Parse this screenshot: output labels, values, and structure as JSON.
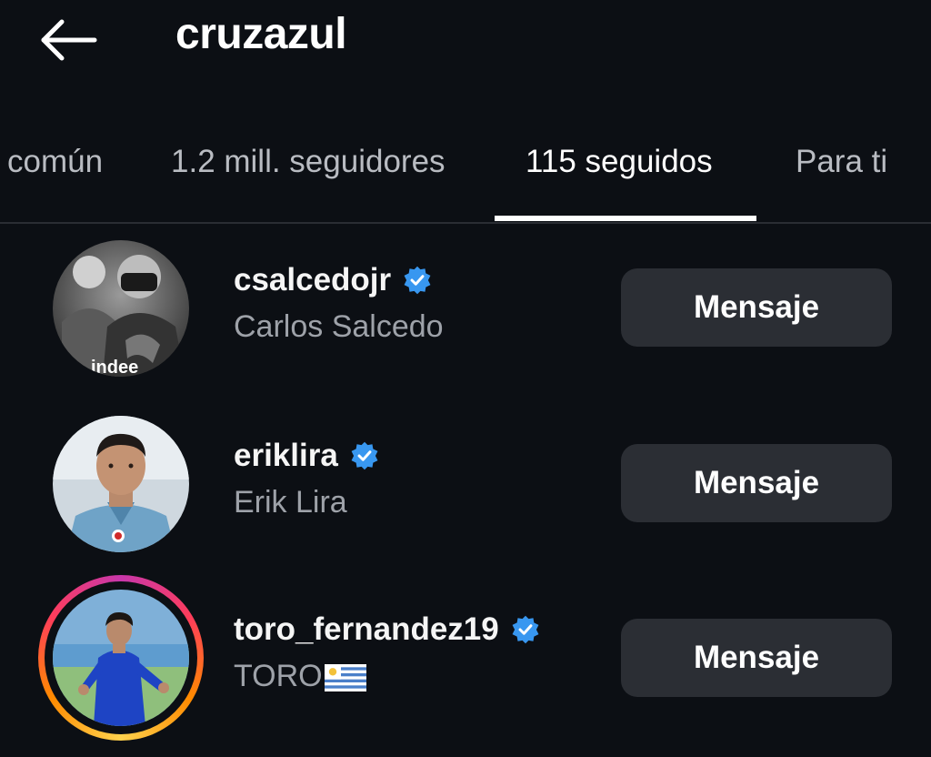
{
  "header": {
    "title": "cruzazul",
    "back_icon": "arrow-left-icon"
  },
  "tabs": [
    {
      "label": "común",
      "active": false
    },
    {
      "label": "1.2 mill. seguidores",
      "active": false
    },
    {
      "label": "115 seguidos",
      "active": true
    },
    {
      "label": "Para ti",
      "active": false
    }
  ],
  "accounts": [
    {
      "username": "csalcedojr",
      "full_name": "Carlos Salcedo",
      "verified": true,
      "has_story": false,
      "avatar_text": "indee",
      "button_label": "Mensaje"
    },
    {
      "username": "eriklira",
      "full_name": "Erik Lira",
      "verified": true,
      "has_story": false,
      "button_label": "Mensaje"
    },
    {
      "username": "toro_fernandez19",
      "full_name": "TORO",
      "full_name_suffix_icon": "uruguay-flag-icon",
      "verified": true,
      "has_story": true,
      "button_label": "Mensaje"
    }
  ],
  "colors": {
    "background": "#0c0f14",
    "button_bg": "#2b2e34",
    "verified_blue": "#3897f0",
    "secondary_text": "#9ea2a9"
  }
}
